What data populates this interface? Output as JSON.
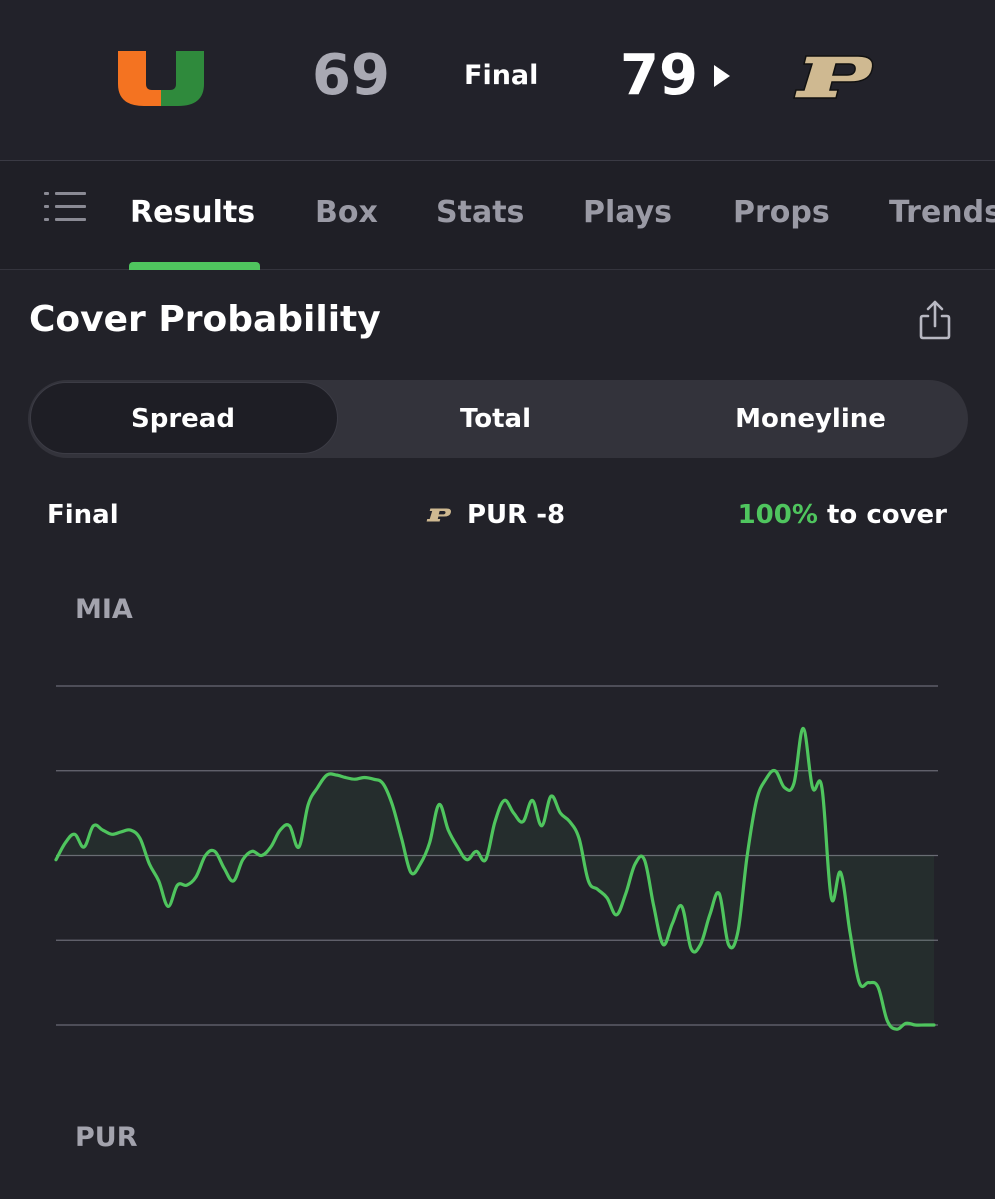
{
  "scoreboard": {
    "away_team": {
      "abbr": "MIA",
      "score": "69",
      "logo_icon": "miami-u-logo"
    },
    "home_team": {
      "abbr": "PUR",
      "score": "79",
      "logo_icon": "purdue-p-logo"
    },
    "status": "Final",
    "winner_indicator_icon": "play-triangle-icon"
  },
  "tabs": [
    "Results",
    "Box",
    "Stats",
    "Plays",
    "Props",
    "Trends"
  ],
  "active_tab": "Results",
  "card": {
    "title": "Cover Probability",
    "share_icon": "share-icon",
    "segments": [
      "Spread",
      "Total",
      "Moneyline"
    ],
    "active_segment": "Spread",
    "status": "Final",
    "line": "PUR -8",
    "cover_pct": "100%",
    "cover_text": " to cover"
  },
  "chart_labels": {
    "top": "MIA",
    "bottom": "PUR"
  },
  "colors": {
    "accent": "#4fc55e",
    "background": "#1f1f26",
    "miami_orange": "#f47321",
    "miami_green": "#005030",
    "purdue_gold": "#cfb991"
  },
  "chart_data": {
    "type": "line",
    "ylim": [
      -2,
      2
    ],
    "grid": true,
    "gridlines": [
      2,
      1,
      0,
      -1,
      -2
    ],
    "series": [
      {
        "x": [
          0,
          1,
          2,
          3,
          4,
          5,
          6,
          7,
          8,
          9,
          10,
          11,
          12,
          13,
          14,
          15,
          16,
          17,
          18,
          19,
          20,
          21,
          22,
          23,
          24,
          25,
          26,
          27,
          28,
          29,
          30,
          31,
          32,
          33,
          34,
          35,
          36,
          37,
          38,
          39,
          40,
          41,
          42,
          43,
          44,
          45,
          46,
          47,
          48,
          49,
          50,
          51,
          52,
          53,
          54,
          55,
          56,
          57,
          58,
          59,
          60,
          61,
          62,
          63,
          64,
          65,
          66,
          67,
          68,
          69,
          70,
          71,
          72,
          73,
          74,
          75,
          76,
          77,
          78,
          79,
          80,
          81,
          82,
          83,
          84,
          85,
          86,
          87,
          88,
          89,
          90,
          91,
          92,
          93,
          94
        ],
        "y": [
          -0.05,
          0.15,
          0.25,
          0.1,
          0.35,
          0.3,
          0.25,
          0.28,
          0.3,
          0.2,
          -0.1,
          -0.3,
          -0.6,
          -0.35,
          -0.35,
          -0.25,
          0,
          0.05,
          -0.15,
          -0.3,
          -0.05,
          0.05,
          0,
          0.1,
          0.3,
          0.35,
          0.1,
          0.6,
          0.8,
          0.95,
          0.95,
          0.92,
          0.9,
          0.92,
          0.9,
          0.85,
          0.6,
          0.2,
          -0.2,
          -0.1,
          0.15,
          0.6,
          0.3,
          0.1,
          -0.05,
          0.05,
          -0.05,
          0.4,
          0.65,
          0.5,
          0.4,
          0.65,
          0.35,
          0.7,
          0.5,
          0.4,
          0.2,
          -0.3,
          -0.4,
          -0.5,
          -0.7,
          -0.45,
          -0.1,
          -0.05,
          -0.6,
          -1.05,
          -0.8,
          -0.6,
          -1.1,
          -1.05,
          -0.7,
          -0.45,
          -1.05,
          -0.9,
          0,
          0.65,
          0.9,
          1.0,
          0.8,
          0.85,
          1.5,
          0.8,
          0.8,
          -0.5,
          -0.2,
          -0.9,
          -1.5,
          -1.5,
          -1.55,
          -1.95,
          -2.05,
          -1.98,
          -2.0,
          -2.0,
          -2.0
        ]
      }
    ]
  }
}
